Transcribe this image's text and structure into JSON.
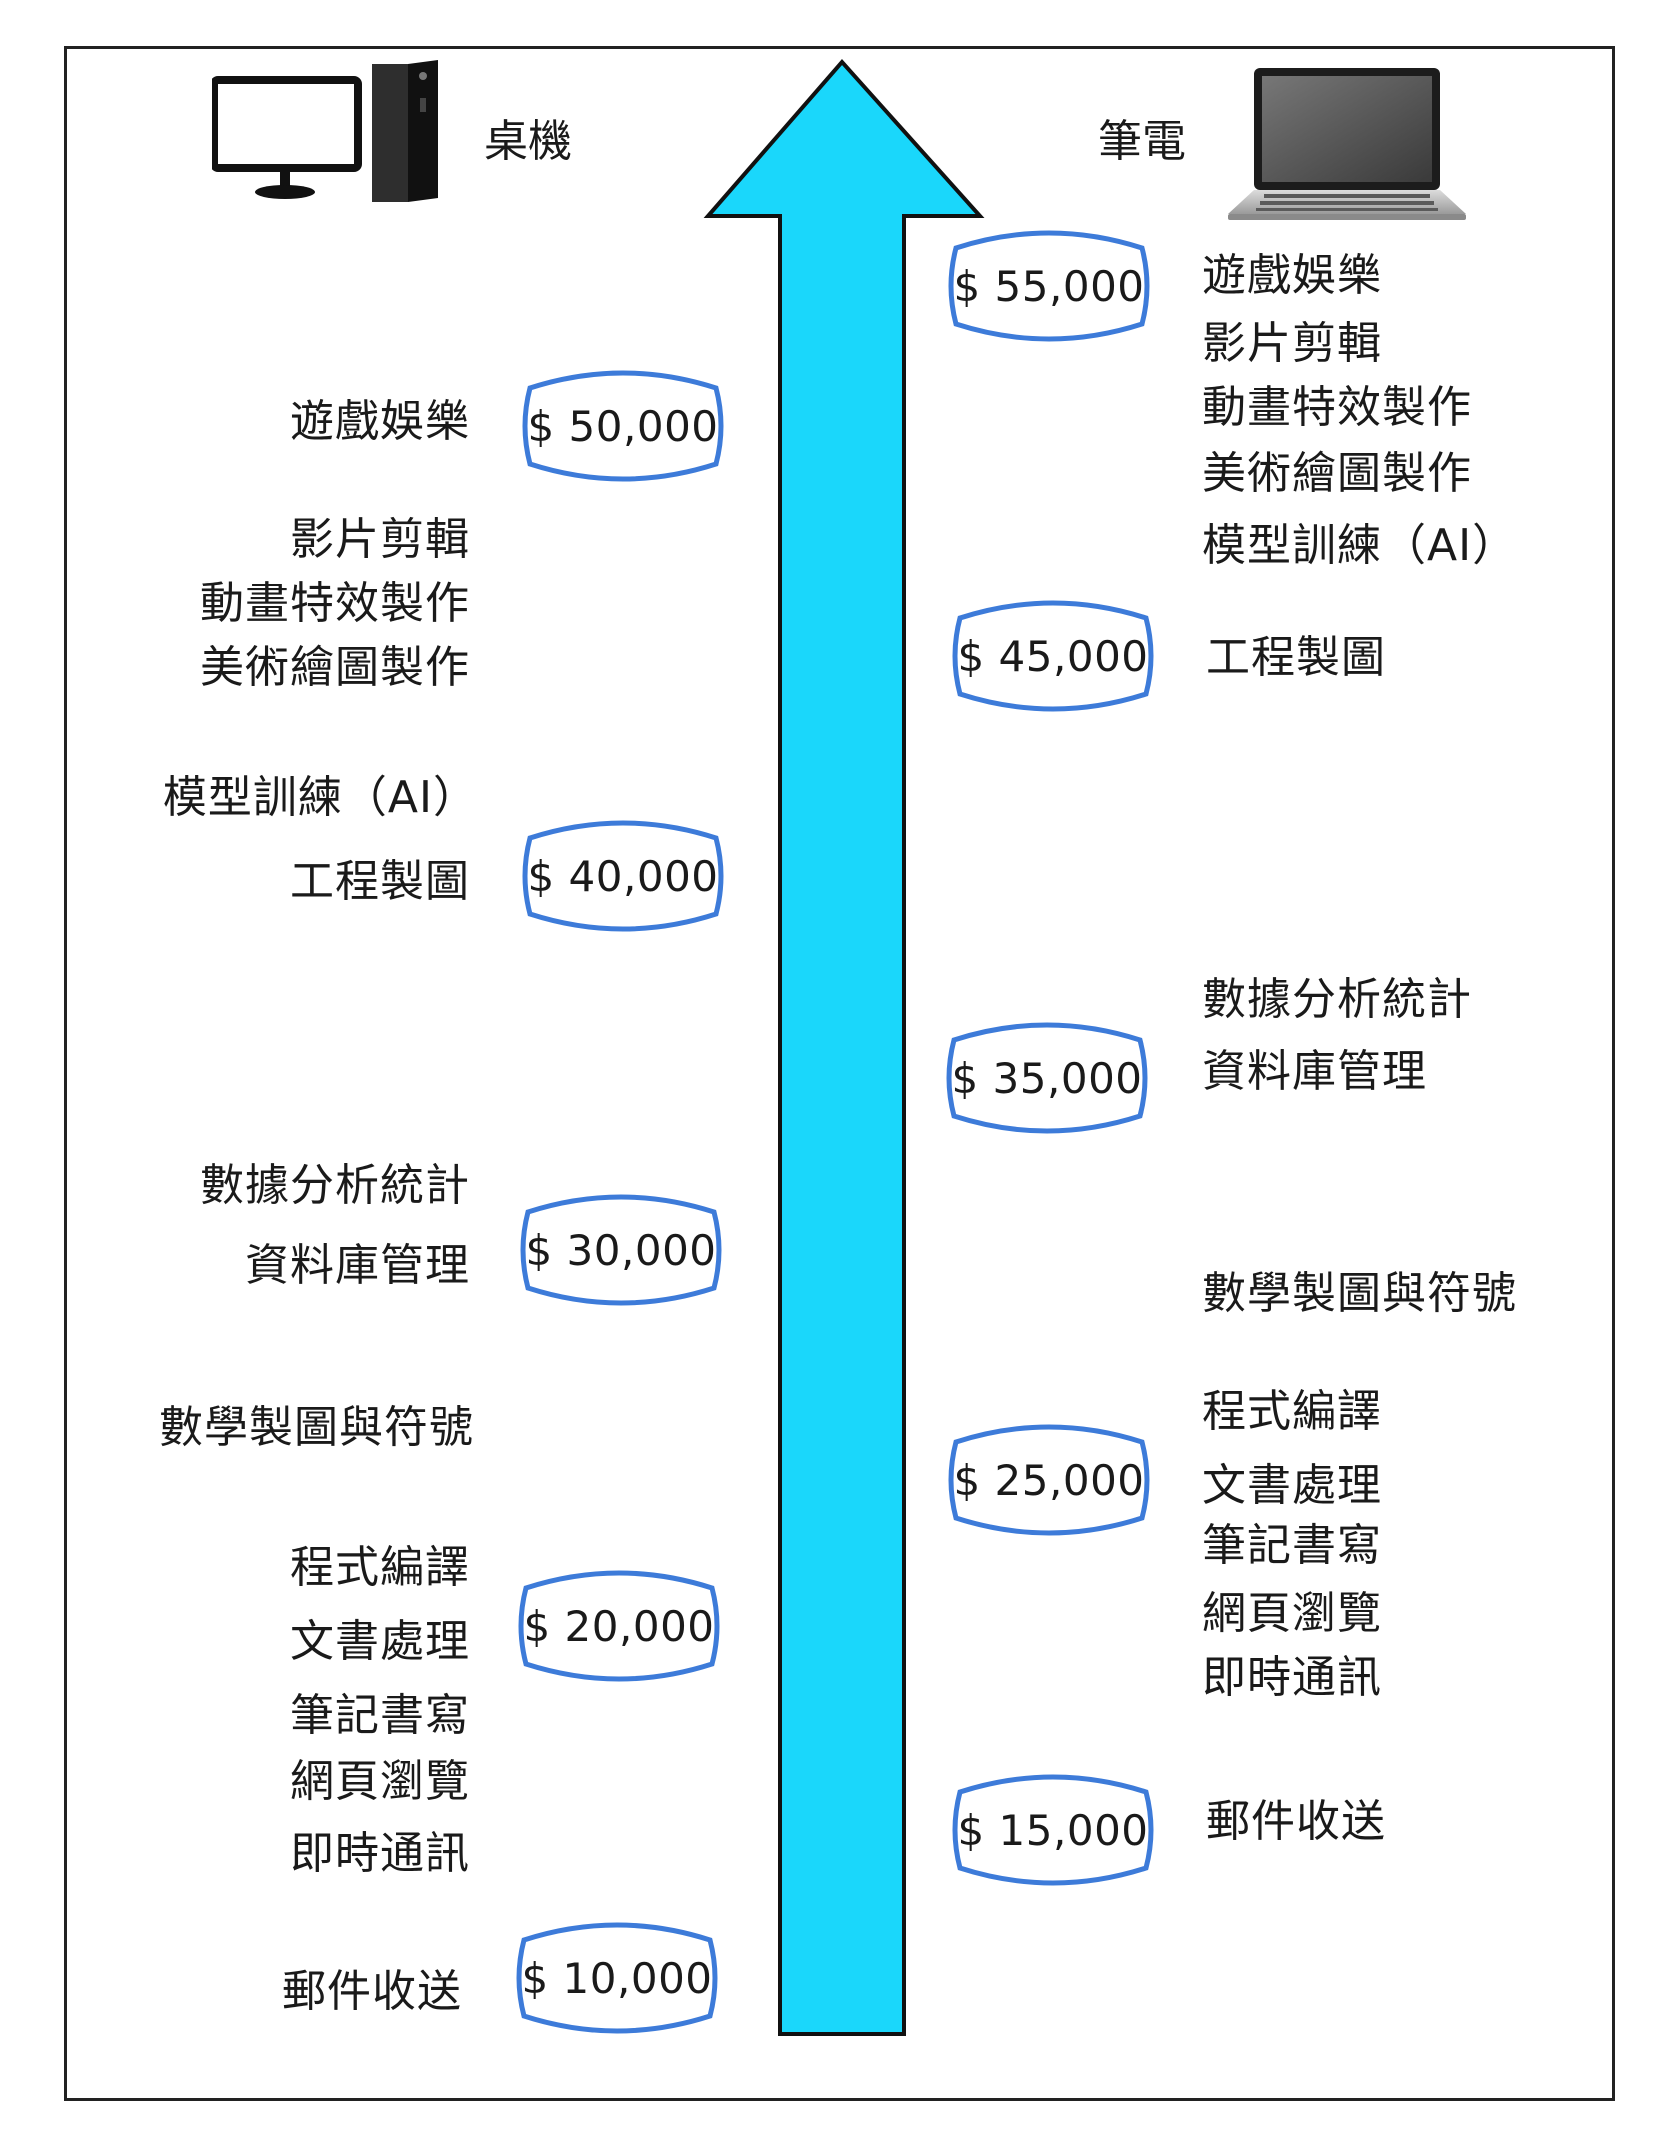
{
  "headers": {
    "desktop": "桌機",
    "laptop": "筆電"
  },
  "icons": {
    "desktop": "desktop-computer-icon",
    "laptop": "laptop-icon"
  },
  "colors": {
    "arrow_fill": "#1ad7fb",
    "arrow_stroke": "#111111",
    "price_border": "#3d7bd9"
  },
  "desktop": {
    "prices": [
      {
        "value": 50000,
        "label": "$ 50,000"
      },
      {
        "value": 40000,
        "label": "$ 40,000"
      },
      {
        "value": 30000,
        "label": "$ 30,000"
      },
      {
        "value": 20000,
        "label": "$ 20,000"
      },
      {
        "value": 10000,
        "label": "$ 10,000"
      }
    ],
    "tasks": [
      "遊戲娛樂",
      "影片剪輯",
      "動畫特效製作",
      "美術繪圖製作",
      "模型訓練（AI）",
      "工程製圖",
      "數據分析統計",
      "資料庫管理",
      "數學製圖與符號",
      "程式編譯",
      "文書處理",
      "筆記書寫",
      "網頁瀏覽",
      "即時通訊",
      "郵件收送"
    ]
  },
  "laptop": {
    "prices": [
      {
        "value": 55000,
        "label": "$ 55,000"
      },
      {
        "value": 45000,
        "label": "$ 45,000"
      },
      {
        "value": 35000,
        "label": "$ 35,000"
      },
      {
        "value": 25000,
        "label": "$ 25,000"
      },
      {
        "value": 15000,
        "label": "$ 15,000"
      }
    ],
    "tasks": [
      "遊戲娛樂",
      "影片剪輯",
      "動畫特效製作",
      "美術繪圖製作",
      "模型訓練（AI）",
      "工程製圖",
      "數據分析統計",
      "資料庫管理",
      "數學製圖與符號",
      "程式編譯",
      "文書處理",
      "筆記書寫",
      "網頁瀏覽",
      "即時通訊",
      "郵件收送"
    ]
  }
}
